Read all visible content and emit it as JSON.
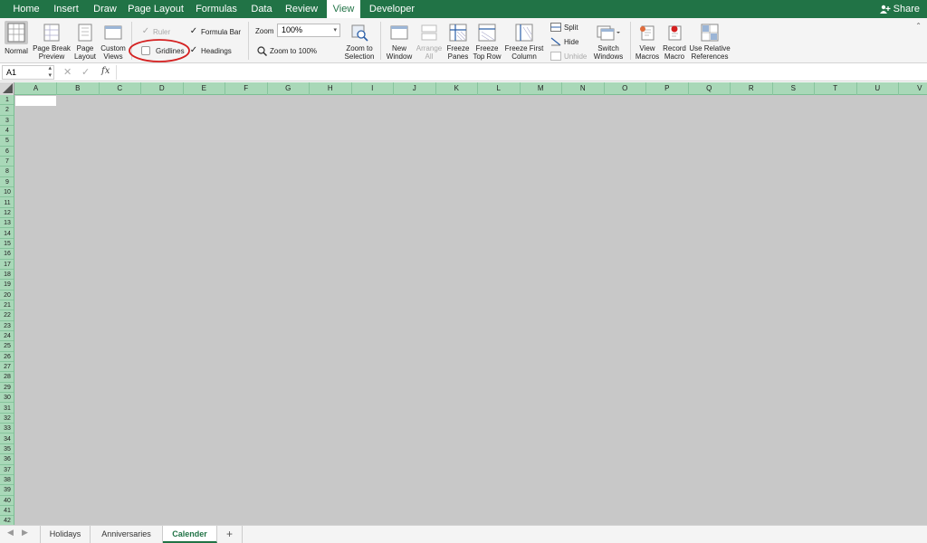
{
  "menubar": {
    "tabs": [
      "Home",
      "Insert",
      "Draw",
      "Page Layout",
      "Formulas",
      "Data",
      "Review",
      "View",
      "Developer"
    ],
    "active_tab": "View",
    "share_label": "Share"
  },
  "ribbon": {
    "workbook_views": [
      {
        "label1": "Normal",
        "label2": ""
      },
      {
        "label1": "Page Break",
        "label2": "Preview"
      },
      {
        "label1": "Page",
        "label2": "Layout"
      },
      {
        "label1": "Custom",
        "label2": "Views"
      }
    ],
    "show": {
      "ruler": "Ruler",
      "formula_bar": "Formula Bar",
      "gridlines": "Gridlines",
      "headings": "Headings"
    },
    "zoom": {
      "label": "Zoom",
      "value": "100%",
      "zoom_100": "Zoom to 100%",
      "zoom_sel1": "Zoom to",
      "zoom_sel2": "Selection"
    },
    "window": [
      {
        "label1": "New",
        "label2": "Window"
      },
      {
        "label1": "Arrange",
        "label2": "All"
      },
      {
        "label1": "Freeze",
        "label2": "Panes"
      },
      {
        "label1": "Freeze",
        "label2": "Top Row"
      },
      {
        "label1": "Freeze First",
        "label2": "Column"
      }
    ],
    "split": "Split",
    "hide": "Hide",
    "unhide": "Unhide",
    "switch": {
      "label1": "Switch",
      "label2": "Windows"
    },
    "macros": [
      {
        "label1": "View",
        "label2": "Macros"
      },
      {
        "label1": "Record",
        "label2": "Macro"
      },
      {
        "label1": "Use Relative",
        "label2": "References"
      }
    ]
  },
  "formula_bar": {
    "name_box": "A1",
    "fx": "fx",
    "content": ""
  },
  "grid": {
    "columns": [
      "A",
      "B",
      "C",
      "D",
      "E",
      "F",
      "G",
      "H",
      "I",
      "J",
      "K",
      "L",
      "M",
      "N",
      "O",
      "P",
      "Q",
      "R",
      "S",
      "T",
      "U",
      "V"
    ],
    "rows": [
      "1",
      "2",
      "3",
      "4",
      "5",
      "6",
      "7",
      "8",
      "9",
      "10",
      "11",
      "12",
      "13",
      "14",
      "15",
      "16",
      "17",
      "18",
      "19",
      "20",
      "21",
      "22",
      "23",
      "24",
      "25",
      "26",
      "27",
      "28",
      "29",
      "30",
      "31",
      "32",
      "33",
      "34",
      "35",
      "36",
      "37",
      "38",
      "39",
      "40",
      "41",
      "42"
    ]
  },
  "sheets": {
    "tabs": [
      "Holidays",
      "Anniversaries",
      "Calender"
    ],
    "active": "Calender",
    "add": "+"
  },
  "colors": {
    "accent": "#217346",
    "header_green": "#a9d8b8",
    "annotation_red": "#d42020"
  }
}
